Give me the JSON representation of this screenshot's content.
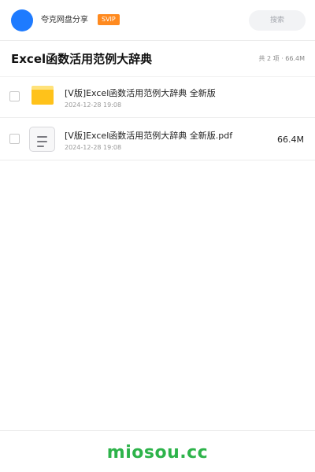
{
  "header": {
    "sharer_name": "夸克网盘分享",
    "badge": "SVIP",
    "search_placeholder": "搜索"
  },
  "page": {
    "title": "Excel函数活用范例大辞典",
    "summary": "共 2 项 · 66.4M"
  },
  "files": [
    {
      "name": "[V版]Excel函数活用范例大辞典 全新版",
      "date": "2024-12-28 19:08",
      "size": "",
      "type": "folder",
      "checked": false
    },
    {
      "name": "[V版]Excel函数活用范例大辞典 全新版.pdf",
      "date": "2024-12-28 19:08",
      "size": "66.4M",
      "type": "document",
      "checked": false
    }
  ],
  "footer": {
    "watermark": "miosou.cc"
  },
  "colors": {
    "avatar": "#1e7bff",
    "svip_badge": "#ff8a1f",
    "folder": "#ffc21a",
    "watermark": "#2db34a"
  }
}
